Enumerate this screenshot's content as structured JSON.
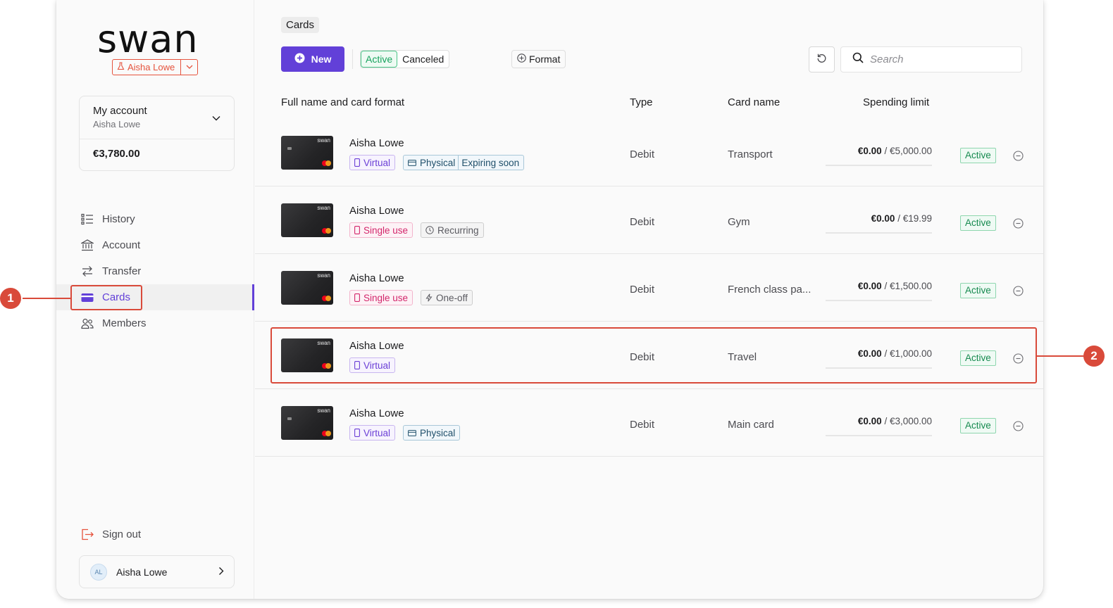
{
  "brand": {
    "logo_text": "swan",
    "project_name": "Aisha Lowe",
    "accent": "#6240d8",
    "annotation_color": "#d94a3a"
  },
  "account": {
    "title": "My account",
    "owner": "Aisha Lowe",
    "balance": "€3,780.00"
  },
  "nav": {
    "items": [
      {
        "label": "History",
        "icon": "history-list-icon"
      },
      {
        "label": "Account",
        "icon": "bank-icon"
      },
      {
        "label": "Transfer",
        "icon": "transfer-arrows-icon"
      },
      {
        "label": "Cards",
        "icon": "credit-card-icon",
        "active": true
      },
      {
        "label": "Members",
        "icon": "people-icon"
      }
    ],
    "sign_out": "Sign out"
  },
  "user": {
    "initials": "AL",
    "name": "Aisha Lowe"
  },
  "breadcrumb": "Cards",
  "toolbar": {
    "new_label": "New",
    "filter_active": "Active",
    "filter_canceled": "Canceled",
    "format_label": "Format",
    "search_placeholder": "Search"
  },
  "table": {
    "headers": {
      "name": "Full name and card format",
      "type": "Type",
      "card_name": "Card name",
      "limit": "Spending limit"
    },
    "rows": [
      {
        "holder": "Aisha Lowe",
        "tag1": "Virtual",
        "tag2": "Physical",
        "tag3": "Expiring soon",
        "type": "Debit",
        "card_name": "Transport",
        "spent": "€0.00",
        "limit": " / €5,000.00",
        "status": "Active"
      },
      {
        "holder": "Aisha Lowe",
        "tag1": "Single use",
        "tag2": "Recurring",
        "type": "Debit",
        "card_name": "Gym",
        "spent": "€0.00",
        "limit": " / €19.99",
        "status": "Active"
      },
      {
        "holder": "Aisha Lowe",
        "tag1": "Single use",
        "tag2": "One-off",
        "type": "Debit",
        "card_name": "French class pa...",
        "spent": "€0.00",
        "limit": " / €1,500.00",
        "status": "Active"
      },
      {
        "holder": "Aisha Lowe",
        "tag1": "Virtual",
        "type": "Debit",
        "card_name": "Travel",
        "spent": "€0.00",
        "limit": " / €1,000.00",
        "status": "Active"
      },
      {
        "holder": "Aisha Lowe",
        "tag1": "Virtual",
        "tag2": "Physical",
        "type": "Debit",
        "card_name": "Main card",
        "spent": "€0.00",
        "limit": " / €3,000.00",
        "status": "Active"
      }
    ],
    "card_logo": "swan"
  },
  "annotations": {
    "one": "1",
    "two": "2"
  }
}
